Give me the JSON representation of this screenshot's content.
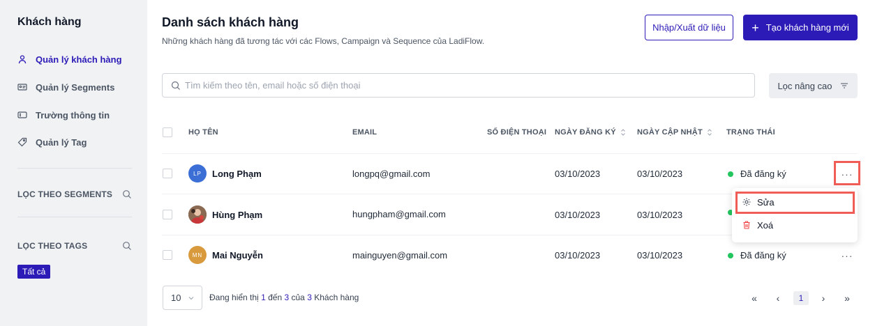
{
  "sidebar": {
    "title": "Khách hàng",
    "items": [
      {
        "label": "Quản lý khách hàng",
        "icon": "user-icon",
        "active": true
      },
      {
        "label": "Quản lý Segments",
        "icon": "id-card-icon",
        "active": false
      },
      {
        "label": "Trường thông tin",
        "icon": "text-field-icon",
        "active": false
      },
      {
        "label": "Quản lý Tag",
        "icon": "tag-icon",
        "active": false
      }
    ],
    "segments_heading": "LỌC THEO SEGMENTS",
    "tags_heading": "LỌC THEO TAGS",
    "tag_all": "Tất cả"
  },
  "header": {
    "title": "Danh sách khách hàng",
    "subtitle": "Những khách hàng đã tương tác với các Flows, Campaign và Sequence của LadiFlow.",
    "import_export_label": "Nhập/Xuất dữ liệu",
    "create_label": "Tạo khách hàng mới"
  },
  "search": {
    "placeholder": "Tìm kiếm theo tên, email hoặc số điện thoại",
    "value": ""
  },
  "filter_label": "Lọc nâng cao",
  "table": {
    "columns": {
      "name": "HỌ TÊN",
      "email": "EMAIL",
      "phone": "SỐ ĐIỆN THOẠI",
      "registered": "NGÀY ĐĂNG KÝ",
      "updated": "NGÀY CẬP NHẬT",
      "status": "TRẠNG THÁI"
    },
    "rows": [
      {
        "initials": "LP",
        "name": "Long Phạm",
        "email": "longpq@gmail.com",
        "phone": "",
        "registered": "03/10/2023",
        "updated": "03/10/2023",
        "status": "Đã đăng ký",
        "more": "···"
      },
      {
        "initials": "",
        "name": "Hùng Phạm",
        "email": "hungpham@gmail.com",
        "phone": "",
        "registered": "03/10/2023",
        "updated": "03/10/2023",
        "status": "",
        "more": ""
      },
      {
        "initials": "MN",
        "name": "Mai Nguyễn",
        "email": "mainguyen@gmail.com",
        "phone": "",
        "registered": "03/10/2023",
        "updated": "03/10/2023",
        "status": "Đã đăng ký",
        "more": "···"
      }
    ]
  },
  "row_menu": {
    "edit": "Sửa",
    "delete": "Xoá"
  },
  "pagination": {
    "page_size": "10",
    "info_prefix": "Đang hiển thị",
    "from": "1",
    "to_word": "đến",
    "to": "3",
    "of_word": "của",
    "total": "3",
    "unit": "Khách hàng",
    "current_page": "1",
    "first": "«",
    "prev": "‹",
    "next": "›",
    "last": "»"
  },
  "colors": {
    "accent": "#2c1bb7",
    "status_green": "#22c55e",
    "highlight": "#ef5d56",
    "sidebar_bg": "#f1f2f4"
  }
}
